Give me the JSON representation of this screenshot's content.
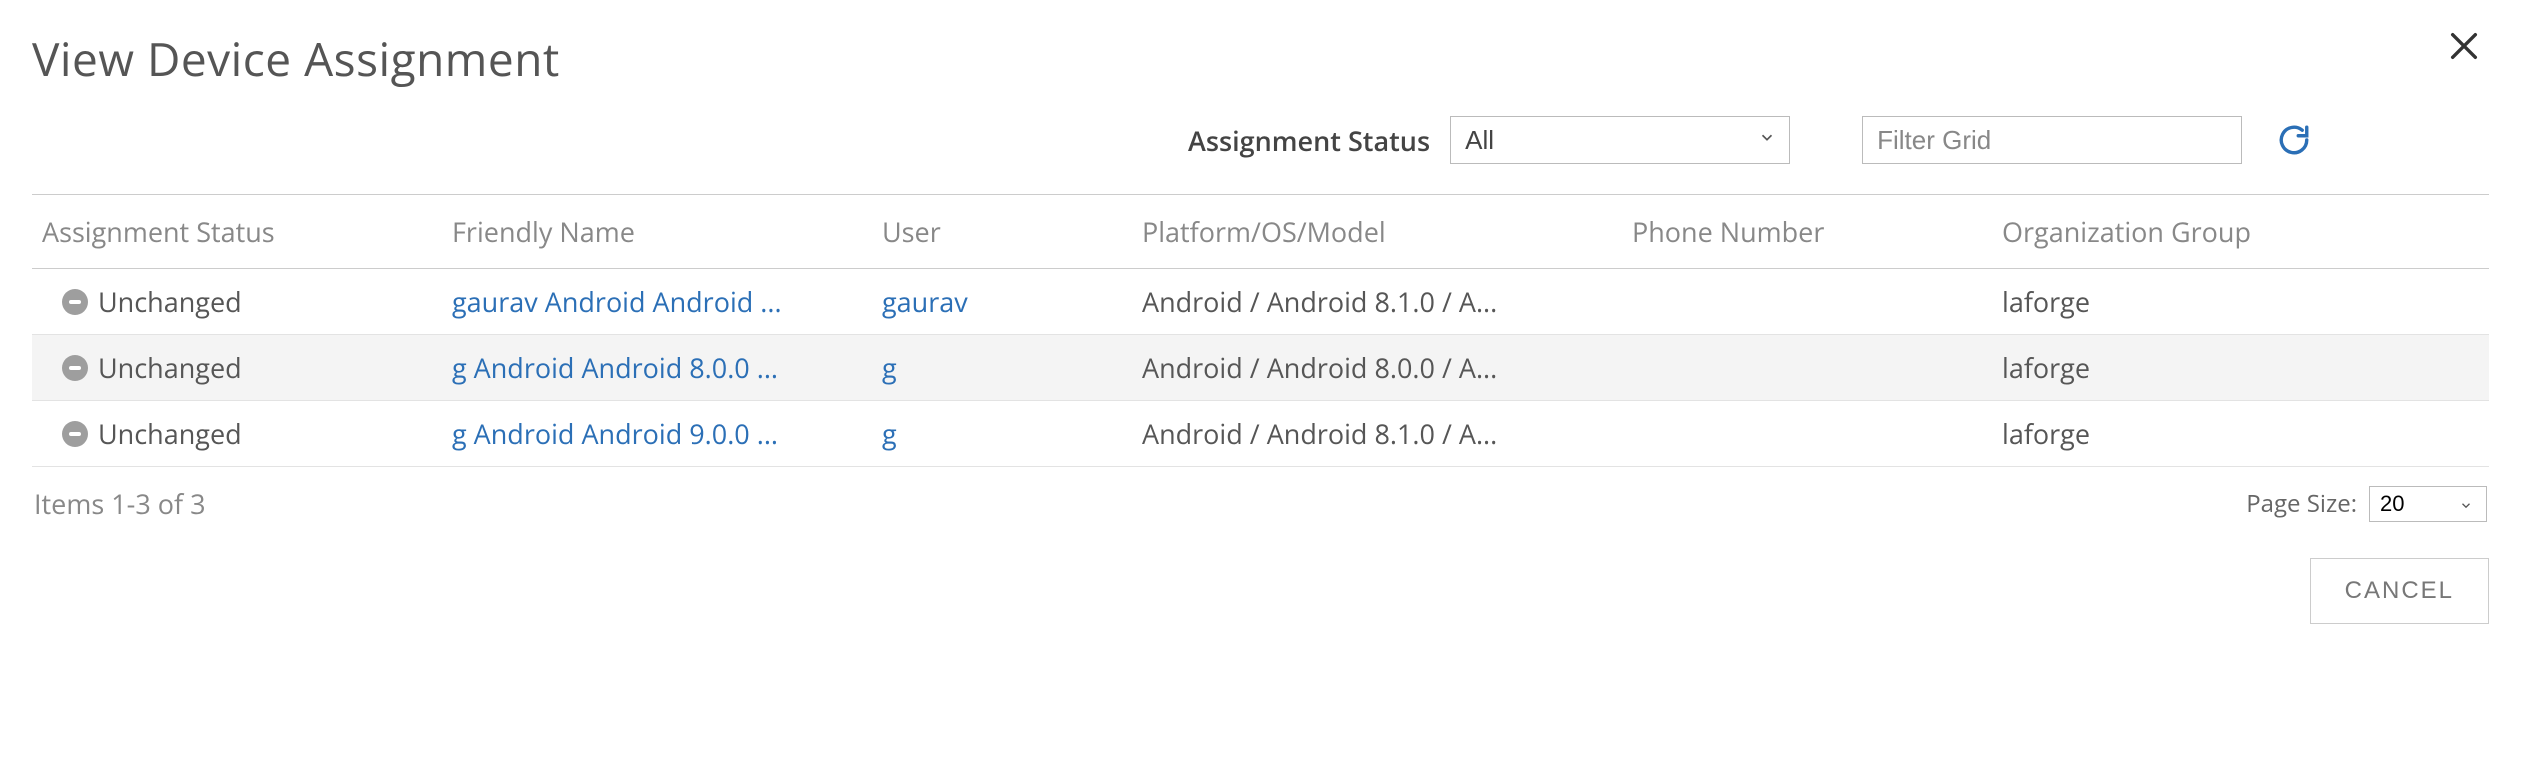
{
  "title": "View Device Assignment",
  "filter": {
    "status_label": "Assignment Status",
    "status_value": "All",
    "filter_placeholder": "Filter Grid"
  },
  "columns": {
    "status": "Assignment Status",
    "friendly": "Friendly Name",
    "user": "User",
    "platform": "Platform/OS/Model",
    "phone": "Phone Number",
    "org": "Organization Group"
  },
  "rows": [
    {
      "status": "Unchanged",
      "friendly": "gaurav Android Android ...",
      "user": "gaurav",
      "platform": "Android / Android 8.1.0 / A...",
      "phone": "",
      "org": "laforge"
    },
    {
      "status": "Unchanged",
      "friendly": "g Android Android 8.0.0 ...",
      "user": "g",
      "platform": "Android / Android 8.0.0 / A...",
      "phone": "",
      "org": "laforge"
    },
    {
      "status": "Unchanged",
      "friendly": "g Android Android 9.0.0 ...",
      "user": "g",
      "platform": "Android / Android 8.1.0 / A...",
      "phone": "",
      "org": "laforge"
    }
  ],
  "footer": {
    "items_text": "Items 1-3 of 3",
    "pagesize_label": "Page Size:",
    "pagesize_value": "20"
  },
  "buttons": {
    "cancel": "CANCEL"
  }
}
